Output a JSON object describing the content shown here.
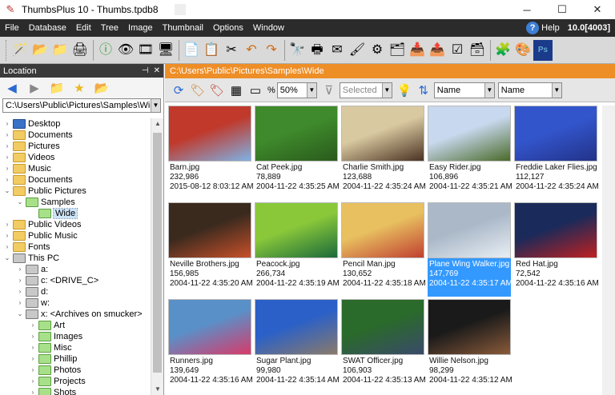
{
  "window": {
    "title": "ThumbsPlus 10 - Thumbs.tpdb8"
  },
  "menu": [
    "File",
    "Database",
    "Edit",
    "Tree",
    "Image",
    "Thumbnail",
    "Options",
    "Window"
  ],
  "help_label": "Help",
  "version_label": "10.0[4003]",
  "location_pane": {
    "title": "Location",
    "path": "C:\\Users\\Public\\Pictures\\Samples\\Wide"
  },
  "tree": [
    {
      "label": "Desktop",
      "icon": "desktop-icon",
      "level": 0,
      "expander": "›"
    },
    {
      "label": "Documents",
      "icon": "folder-icon",
      "level": 0,
      "expander": "›"
    },
    {
      "label": "Pictures",
      "icon": "folder-icon",
      "level": 0,
      "expander": "›"
    },
    {
      "label": "Videos",
      "icon": "folder-icon",
      "level": 0,
      "expander": "›"
    },
    {
      "label": "Music",
      "icon": "folder-icon",
      "level": 0,
      "expander": "›"
    },
    {
      "label": "Documents",
      "icon": "folder-icon",
      "level": 0,
      "expander": "›"
    },
    {
      "label": "Public Pictures",
      "icon": "folder-icon",
      "level": 0,
      "expander": "⌄"
    },
    {
      "label": "Samples",
      "icon": "folder-green-icon",
      "level": 1,
      "expander": "⌄"
    },
    {
      "label": "Wide",
      "icon": "folder-green-icon",
      "level": 2,
      "expander": "",
      "selected": true
    },
    {
      "label": "Public Videos",
      "icon": "folder-icon",
      "level": 0,
      "expander": "›"
    },
    {
      "label": "Public Music",
      "icon": "folder-icon",
      "level": 0,
      "expander": "›"
    },
    {
      "label": "Fonts",
      "icon": "folder-icon",
      "level": 0,
      "expander": "›"
    },
    {
      "label": "This PC",
      "icon": "drive-icon",
      "level": 0,
      "expander": "⌄"
    },
    {
      "label": "a:",
      "icon": "drive-icon",
      "level": 1,
      "expander": "›"
    },
    {
      "label": "c: <DRIVE_C>",
      "icon": "drive-icon",
      "level": 1,
      "expander": "›"
    },
    {
      "label": "d:",
      "icon": "drive-icon",
      "level": 1,
      "expander": "›"
    },
    {
      "label": "w:",
      "icon": "drive-icon",
      "level": 1,
      "expander": "›"
    },
    {
      "label": "x: <Archives on smucker>",
      "icon": "drive-icon",
      "level": 1,
      "expander": "⌄"
    },
    {
      "label": "Art",
      "icon": "folder-green-icon",
      "level": 2,
      "expander": "›"
    },
    {
      "label": "Images",
      "icon": "folder-green-icon",
      "level": 2,
      "expander": "›"
    },
    {
      "label": "Misc",
      "icon": "folder-green-icon",
      "level": 2,
      "expander": "›"
    },
    {
      "label": "Phillip",
      "icon": "folder-green-icon",
      "level": 2,
      "expander": "›"
    },
    {
      "label": "Photos",
      "icon": "folder-green-icon",
      "level": 2,
      "expander": "›"
    },
    {
      "label": "Projects",
      "icon": "folder-green-icon",
      "level": 2,
      "expander": "›"
    },
    {
      "label": "Shots",
      "icon": "folder-green-icon",
      "level": 2,
      "expander": "›"
    }
  ],
  "content": {
    "path": "C:\\Users\\Public\\Pictures\\Samples\\Wide",
    "zoom_label": "%",
    "zoom": "50%",
    "filter_placeholder": "Selected",
    "sort_field_1": "Name",
    "sort_field_2": "Name"
  },
  "thumbnails": [
    {
      "name": "Barn.jpg",
      "size": "232,986",
      "date": "2015-08-12  8:03:12 AM",
      "colors": [
        "#c0392b",
        "#7fb2e5"
      ]
    },
    {
      "name": "Cat Peek.jpg",
      "size": "78,889",
      "date": "2004-11-22  4:35:25 AM",
      "colors": [
        "#3f8a2c",
        "#2a5a1c"
      ]
    },
    {
      "name": "Charlie Smith.jpg",
      "size": "123,688",
      "date": "2004-11-22  4:35:24 AM",
      "colors": [
        "#d9c9a0",
        "#4a3222"
      ]
    },
    {
      "name": "Easy Rider.jpg",
      "size": "106,896",
      "date": "2004-11-22  4:35:21 AM",
      "colors": [
        "#c8d8ee",
        "#4a6a2a"
      ]
    },
    {
      "name": "Freddie Laker Flies.jpg",
      "size": "112,127",
      "date": "2004-11-22  4:35:24 AM",
      "colors": [
        "#3355cc",
        "#223388"
      ]
    },
    {
      "name": "Neville Brothers.jpg",
      "size": "156,985",
      "date": "2004-11-22  4:35:20 AM",
      "colors": [
        "#3a2a1e",
        "#c8502a"
      ]
    },
    {
      "name": "Peacock.jpg",
      "size": "266,734",
      "date": "2004-11-22  4:35:19 AM",
      "colors": [
        "#8ac83a",
        "#1a6a3a"
      ]
    },
    {
      "name": "Pencil Man.jpg",
      "size": "130,652",
      "date": "2004-11-22  4:35:18 AM",
      "colors": [
        "#e8c060",
        "#c04030"
      ]
    },
    {
      "name": "Plane Wing Walker.jpg",
      "size": "147,769",
      "date": "2004-11-22  4:35:17 AM",
      "colors": [
        "#aab8c8",
        "#e8eef4"
      ],
      "selected": true
    },
    {
      "name": "Red Hat.jpg",
      "size": "72,542",
      "date": "2004-11-22  4:35:16 AM",
      "colors": [
        "#1a2a5a",
        "#c02020"
      ]
    },
    {
      "name": "Runners.jpg",
      "size": "139,649",
      "date": "2004-11-22  4:35:16 AM",
      "colors": [
        "#5a90c8",
        "#d83a6a"
      ]
    },
    {
      "name": "Sugar Plant.jpg",
      "size": "99,980",
      "date": "2004-11-22  4:35:14 AM",
      "colors": [
        "#2a60c8",
        "#8a7a6a"
      ]
    },
    {
      "name": "SWAT Officer.jpg",
      "size": "106,903",
      "date": "2004-11-22  4:35:13 AM",
      "colors": [
        "#2a6a2a",
        "#3a4a6a"
      ]
    },
    {
      "name": "Willie Nelson.jpg",
      "size": "98,299",
      "date": "2004-11-22  4:35:12 AM",
      "colors": [
        "#1a1a1a",
        "#8a5a3a"
      ]
    }
  ]
}
